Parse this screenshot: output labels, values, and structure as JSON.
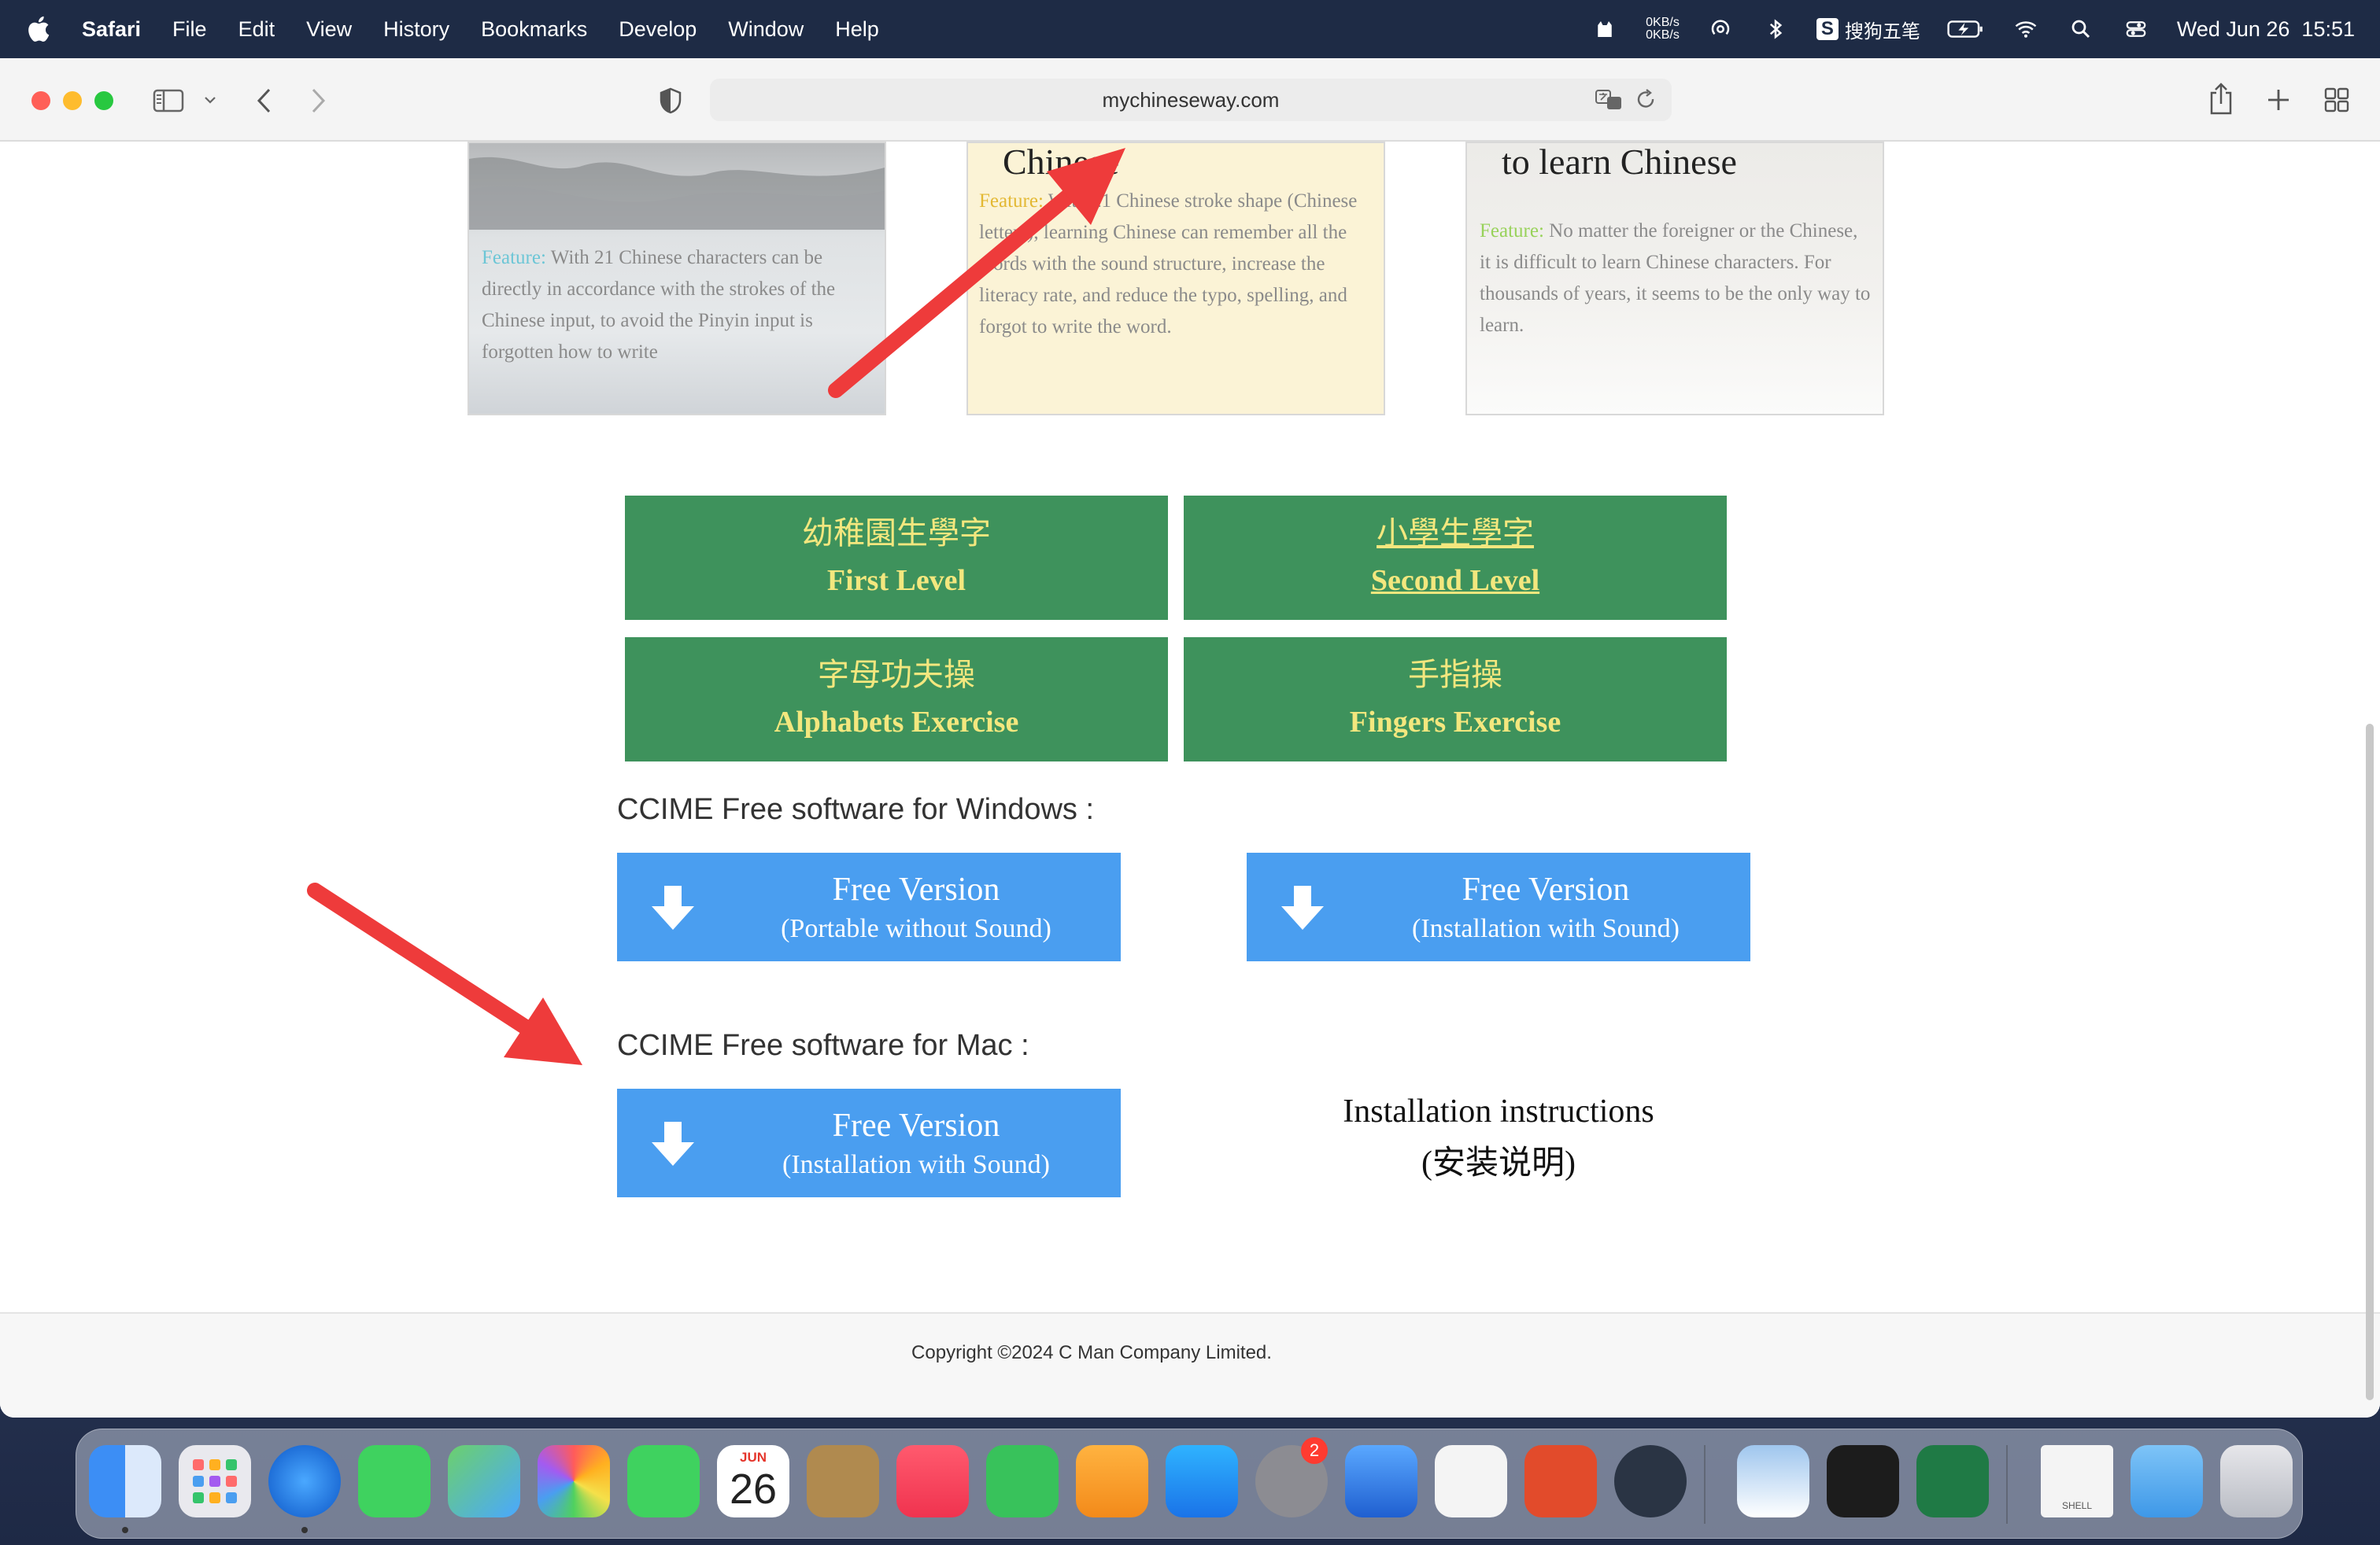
{
  "menubar": {
    "app_name": "Safari",
    "menus": [
      "File",
      "Edit",
      "View",
      "History",
      "Bookmarks",
      "Develop",
      "Window",
      "Help"
    ],
    "net_up": "0KB/s",
    "net_down": "0KB/s",
    "ime_label": "搜狗五笔",
    "datetime": "Wed Jun 26  15:51"
  },
  "browser": {
    "url": "mychineseway.com"
  },
  "cards": [
    {
      "title": "",
      "feature_label": "Feature:",
      "text": " With 21 Chinese characters can be directly in accordance with the strokes of the Chinese input, to avoid the Pinyin input is forgotten how to write"
    },
    {
      "title": "Chinese",
      "feature_label": "Feature:",
      "text": " With 21 Chinese stroke shape (Chinese letters), learning Chinese can remember all the words with the sound structure, increase the literacy rate, and reduce the typo, spelling, and forgot to write the word."
    },
    {
      "title": "to learn Chinese",
      "feature_label": "Feature:",
      "text": " No matter the foreigner or the Chinese, it is difficult to learn Chinese characters. For thousands of years, it seems to be the only way to learn."
    }
  ],
  "levels": [
    {
      "cn": "幼稚園生學字",
      "en": "First Level"
    },
    {
      "cn": "小學生學字",
      "en": "Second Level"
    },
    {
      "cn": "字母功夫操",
      "en": "Alphabets Exercise"
    },
    {
      "cn": "手指操",
      "en": "Fingers Exercise"
    }
  ],
  "windows_section": {
    "heading": "CCIME Free software for Windows :",
    "buttons": [
      {
        "title": "Free Version",
        "subtitle": "(Portable without Sound)"
      },
      {
        "title": "Free Version",
        "subtitle": "(Installation with Sound)"
      }
    ]
  },
  "mac_section": {
    "heading": "CCIME Free software for Mac :",
    "button": {
      "title": "Free Version",
      "subtitle": "(Installation with Sound)"
    },
    "instructions_line1": "Installation instructions",
    "instructions_line2": "(安装说明)"
  },
  "footer": {
    "copyright": "Copyright ©2024 C Man Company Limited."
  },
  "dock": {
    "calendar_month": "JUN",
    "calendar_day": "26",
    "settings_badge": "2",
    "shell_label": "SHELL"
  },
  "colors": {
    "level_green": "#3e925c",
    "level_text": "#f3e77e",
    "download_blue": "#4a9ef0",
    "annotation_red": "#ee3b3b"
  }
}
